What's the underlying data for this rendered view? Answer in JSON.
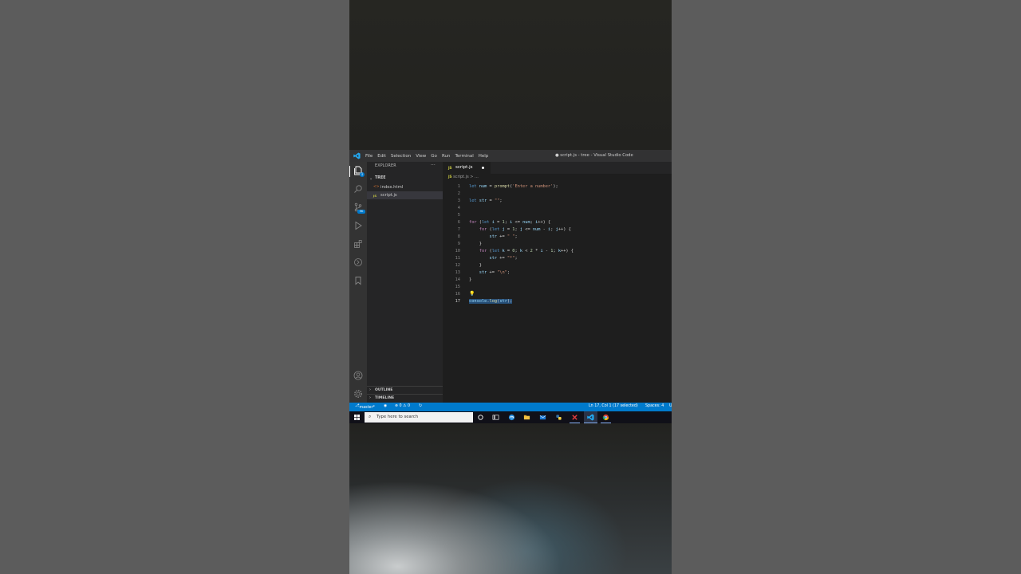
{
  "titlebar": {
    "menu": [
      "File",
      "Edit",
      "Selection",
      "View",
      "Go",
      "Run",
      "Terminal",
      "Help"
    ],
    "window_title": "● script.js - tree - Visual Studio Code"
  },
  "sidebar": {
    "header": "EXPLORER",
    "more": "···",
    "folder": "TREE",
    "files": [
      {
        "icon": "<>",
        "name": "index.html"
      },
      {
        "icon": "JS",
        "name": "script.js"
      }
    ],
    "outline": "OUTLINE",
    "timeline": "TIMELINE"
  },
  "activity": {
    "badge": "1",
    "scm_badge": "5K"
  },
  "tab": {
    "icon": "JS",
    "name": "script.js"
  },
  "breadcrumb": {
    "icon": "JS",
    "text": "script.js > ..."
  },
  "code_lines": [
    {
      "n": "1"
    },
    {
      "n": "2"
    },
    {
      "n": "3"
    },
    {
      "n": "4"
    },
    {
      "n": "5"
    },
    {
      "n": "6"
    },
    {
      "n": "7"
    },
    {
      "n": "8"
    },
    {
      "n": "9"
    },
    {
      "n": "10"
    },
    {
      "n": "11"
    },
    {
      "n": "12"
    },
    {
      "n": "13"
    },
    {
      "n": "14"
    },
    {
      "n": "15"
    },
    {
      "n": "16"
    },
    {
      "n": "17"
    }
  ],
  "status": {
    "branch": "master*",
    "errors": "⊗ 0 ⚠ 0",
    "position": "Ln 17, Col 1 (17 selected)",
    "spaces": "Spaces: 4",
    "encoding": "U"
  },
  "taskbar": {
    "search_placeholder": "Type here to search"
  },
  "colors": {
    "accent": "#007acc",
    "editor_bg": "#1e1e1e",
    "sidebar_bg": "#252526"
  }
}
